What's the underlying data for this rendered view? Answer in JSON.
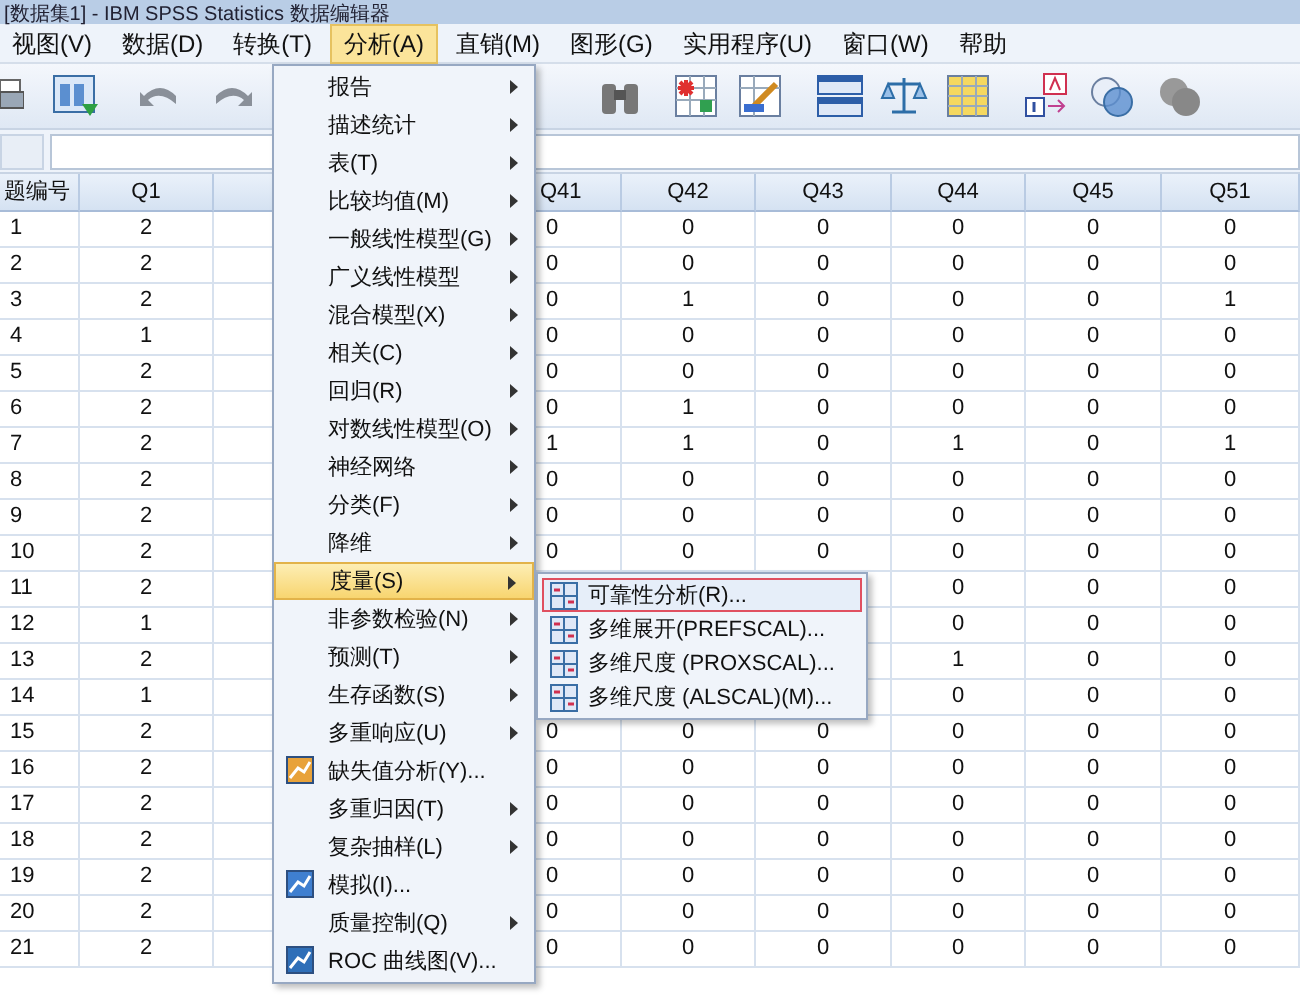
{
  "window": {
    "title": "[数据集1] - IBM SPSS Statistics 数据编辑器"
  },
  "menu_bar": [
    {
      "label": "视图(V)",
      "selected": false
    },
    {
      "label": "数据(D)",
      "selected": false
    },
    {
      "label": "转换(T)",
      "selected": false
    },
    {
      "label": "分析(A)",
      "selected": true
    },
    {
      "label": "直销(M)",
      "selected": false
    },
    {
      "label": "图形(G)",
      "selected": false
    },
    {
      "label": "实用程序(U)",
      "selected": false
    },
    {
      "label": "窗口(W)",
      "selected": false
    },
    {
      "label": "帮助",
      "selected": false
    }
  ],
  "grid": {
    "columns": [
      "题编号",
      "Q1",
      "Q41",
      "Q42",
      "Q43",
      "Q44",
      "Q45",
      "Q51"
    ],
    "rows": [
      {
        "cells": [
          "1",
          "2",
          "0",
          "0",
          "0",
          "0",
          "0",
          "0"
        ]
      },
      {
        "cells": [
          "2",
          "2",
          "0",
          "0",
          "0",
          "0",
          "0",
          "0"
        ]
      },
      {
        "cells": [
          "3",
          "2",
          "0",
          "1",
          "0",
          "0",
          "0",
          "1"
        ]
      },
      {
        "cells": [
          "4",
          "1",
          "0",
          "0",
          "0",
          "0",
          "0",
          "0"
        ]
      },
      {
        "cells": [
          "5",
          "2",
          "0",
          "0",
          "0",
          "0",
          "0",
          "0"
        ]
      },
      {
        "cells": [
          "6",
          "2",
          "0",
          "1",
          "0",
          "0",
          "0",
          "0"
        ]
      },
      {
        "cells": [
          "7",
          "2",
          "1",
          "1",
          "0",
          "1",
          "0",
          "1"
        ]
      },
      {
        "cells": [
          "8",
          "2",
          "0",
          "0",
          "0",
          "0",
          "0",
          "0"
        ]
      },
      {
        "cells": [
          "9",
          "2",
          "0",
          "0",
          "0",
          "0",
          "0",
          "0"
        ]
      },
      {
        "cells": [
          "10",
          "2",
          "0",
          "0",
          "0",
          "0",
          "0",
          "0"
        ]
      },
      {
        "cells": [
          "11",
          "2",
          null,
          null,
          null,
          "0",
          "0",
          "0"
        ]
      },
      {
        "cells": [
          "12",
          "1",
          null,
          null,
          null,
          "0",
          "0",
          "0"
        ]
      },
      {
        "cells": [
          "13",
          "2",
          null,
          null,
          null,
          "1",
          "0",
          "0"
        ]
      },
      {
        "cells": [
          "14",
          "1",
          null,
          null,
          null,
          "0",
          "0",
          "0"
        ]
      },
      {
        "cells": [
          "15",
          "2",
          "0",
          "0",
          "0",
          "0",
          "0",
          "0"
        ]
      },
      {
        "cells": [
          "16",
          "2",
          "0",
          "0",
          "0",
          "0",
          "0",
          "0"
        ]
      },
      {
        "cells": [
          "17",
          "2",
          "0",
          "0",
          "0",
          "0",
          "0",
          "0"
        ]
      },
      {
        "cells": [
          "18",
          "2",
          "0",
          "0",
          "0",
          "0",
          "0",
          "0"
        ]
      },
      {
        "cells": [
          "19",
          "2",
          "0",
          "0",
          "0",
          "0",
          "0",
          "0"
        ]
      },
      {
        "cells": [
          "20",
          "2",
          "0",
          "0",
          "0",
          "0",
          "0",
          "0"
        ]
      },
      {
        "cells": [
          "21",
          "2",
          "0",
          "0",
          "0",
          "0",
          "0",
          "0"
        ]
      }
    ]
  },
  "analyze_menu": {
    "items": [
      {
        "label": "报告",
        "kind": "submenu",
        "selected": false
      },
      {
        "label": "描述统计",
        "kind": "submenu",
        "selected": false
      },
      {
        "label": "表(T)",
        "kind": "submenu",
        "selected": false
      },
      {
        "label": "比较均值(M)",
        "kind": "submenu",
        "selected": false
      },
      {
        "label": "一般线性模型(G)",
        "kind": "submenu",
        "selected": false
      },
      {
        "label": "广义线性模型",
        "kind": "submenu",
        "selected": false
      },
      {
        "label": "混合模型(X)",
        "kind": "submenu",
        "selected": false
      },
      {
        "label": "相关(C)",
        "kind": "submenu",
        "selected": false
      },
      {
        "label": "回归(R)",
        "kind": "submenu",
        "selected": false
      },
      {
        "label": "对数线性模型(O)",
        "kind": "submenu",
        "selected": false
      },
      {
        "label": "神经网络",
        "kind": "submenu",
        "selected": false
      },
      {
        "label": "分类(F)",
        "kind": "submenu",
        "selected": false
      },
      {
        "label": "降维",
        "kind": "submenu",
        "selected": false
      },
      {
        "label": "度量(S)",
        "kind": "submenu",
        "selected": true
      },
      {
        "label": "非参数检验(N)",
        "kind": "submenu",
        "selected": false
      },
      {
        "label": "预测(T)",
        "kind": "submenu",
        "selected": false
      },
      {
        "label": "生存函数(S)",
        "kind": "submenu",
        "selected": false
      },
      {
        "label": "多重响应(U)",
        "kind": "submenu",
        "selected": false
      },
      {
        "label": "缺失值分析(Y)...",
        "kind": "dialog",
        "selected": false
      },
      {
        "label": "多重归因(T)",
        "kind": "submenu",
        "selected": false
      },
      {
        "label": "复杂抽样(L)",
        "kind": "submenu",
        "selected": false
      },
      {
        "label": "模拟(I)...",
        "kind": "dialog",
        "selected": false
      },
      {
        "label": "质量控制(Q)",
        "kind": "submenu",
        "selected": false
      },
      {
        "label": "ROC 曲线图(V)...",
        "kind": "dialog",
        "selected": false
      }
    ]
  },
  "scale_submenu": {
    "items": [
      {
        "label": "可靠性分析(R)...",
        "selected": true
      },
      {
        "label": "多维展开(PREFSCAL)...",
        "selected": false
      },
      {
        "label": "多维尺度 (PROXSCAL)...",
        "selected": false
      },
      {
        "label": "多维尺度 (ALSCAL)(M)...",
        "selected": false
      }
    ]
  }
}
